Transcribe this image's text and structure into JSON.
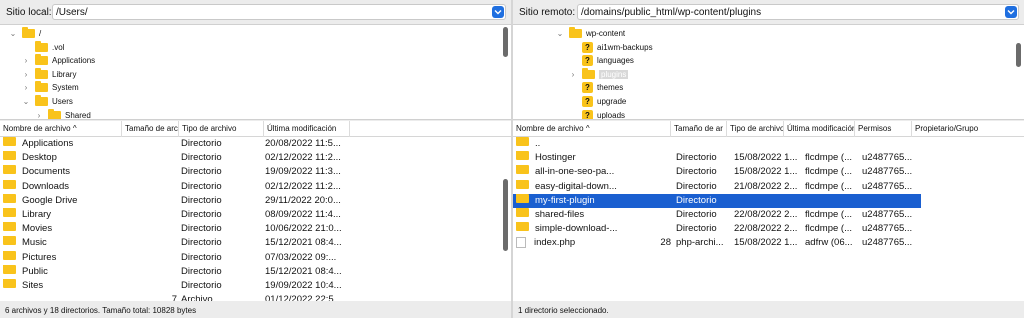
{
  "local": {
    "label": "Sitio local:",
    "path": "/Users/",
    "tree": [
      {
        "label": "/",
        "depth": 0,
        "twisty": "down"
      },
      {
        "label": ".vol",
        "depth": 1,
        "twisty": ""
      },
      {
        "label": "Applications",
        "depth": 1,
        "twisty": "right"
      },
      {
        "label": "Library",
        "depth": 1,
        "twisty": "right"
      },
      {
        "label": "System",
        "depth": 1,
        "twisty": "right"
      },
      {
        "label": "Users",
        "depth": 1,
        "twisty": "down"
      },
      {
        "label": "Shared",
        "depth": 2,
        "twisty": "right"
      }
    ],
    "columns": [
      "Nombre de archivo",
      "Tamaño de archivo",
      "Tipo de archivo",
      "Última modificación"
    ],
    "rows": [
      {
        "name": "Applications",
        "size": "",
        "type": "Directorio",
        "modified": "20/08/2022 11:5..."
      },
      {
        "name": "Desktop",
        "size": "",
        "type": "Directorio",
        "modified": "02/12/2022 11:2..."
      },
      {
        "name": "Documents",
        "size": "",
        "type": "Directorio",
        "modified": "19/09/2022 11:3..."
      },
      {
        "name": "Downloads",
        "size": "",
        "type": "Directorio",
        "modified": "02/12/2022 11:2..."
      },
      {
        "name": "Google Drive",
        "size": "",
        "type": "Directorio",
        "modified": "29/11/2022 20:0..."
      },
      {
        "name": "Library",
        "size": "",
        "type": "Directorio",
        "modified": "08/09/2022 11:4..."
      },
      {
        "name": "Movies",
        "size": "",
        "type": "Directorio",
        "modified": "10/06/2022 21:0..."
      },
      {
        "name": "Music",
        "size": "",
        "type": "Directorio",
        "modified": "15/12/2021 08:4..."
      },
      {
        "name": "Pictures",
        "size": "",
        "type": "Directorio",
        "modified": "07/03/2022 09:..."
      },
      {
        "name": "Public",
        "size": "",
        "type": "Directorio",
        "modified": "15/12/2021 08:4..."
      },
      {
        "name": "Sites",
        "size": "",
        "type": "Directorio",
        "modified": "19/09/2022 10:4..."
      },
      {
        "name": "",
        "size": "7",
        "type": "Archivo",
        "modified": "01/12/2022 22:5..."
      }
    ],
    "status": "6 archivos y 18 directorios. Tamaño total: 10828 bytes"
  },
  "remote": {
    "label": "Sitio remoto:",
    "path": "/domains/public_html/wp-content/plugins",
    "tree": [
      {
        "label": "wp-content",
        "depth": 0,
        "twisty": "down",
        "icon": "folder"
      },
      {
        "label": "ai1wm-backups",
        "depth": 1,
        "twisty": "",
        "icon": "question"
      },
      {
        "label": "languages",
        "depth": 1,
        "twisty": "",
        "icon": "question"
      },
      {
        "label": "plugins",
        "depth": 1,
        "twisty": "right",
        "icon": "folder",
        "selected": true
      },
      {
        "label": "themes",
        "depth": 1,
        "twisty": "",
        "icon": "question"
      },
      {
        "label": "upgrade",
        "depth": 1,
        "twisty": "",
        "icon": "question"
      },
      {
        "label": "uploads",
        "depth": 1,
        "twisty": "",
        "icon": "question"
      }
    ],
    "columns": [
      "Nombre de archivo",
      "Tamaño de ar",
      "Tipo de archivo",
      "Última modificación",
      "Permisos",
      "Propietario/Grupo"
    ],
    "rows": [
      {
        "name": "..",
        "size": "",
        "type": "",
        "modified": "",
        "perms": "",
        "owner": "",
        "icon": "folder"
      },
      {
        "name": "Hostinger",
        "size": "",
        "type": "Directorio",
        "modified": "15/08/2022 1...",
        "perms": "flcdmpe (...",
        "owner": "u2487765...",
        "icon": "folder"
      },
      {
        "name": "all-in-one-seo-pa...",
        "size": "",
        "type": "Directorio",
        "modified": "15/08/2022 1...",
        "perms": "flcdmpe (...",
        "owner": "u2487765...",
        "icon": "folder"
      },
      {
        "name": "easy-digital-down...",
        "size": "",
        "type": "Directorio",
        "modified": "21/08/2022 2...",
        "perms": "flcdmpe (...",
        "owner": "u2487765...",
        "icon": "folder"
      },
      {
        "name": "my-first-plugin",
        "size": "",
        "type": "Directorio",
        "modified": "",
        "perms": "",
        "owner": "",
        "icon": "folder",
        "selected": true
      },
      {
        "name": "shared-files",
        "size": "",
        "type": "Directorio",
        "modified": "22/08/2022 2...",
        "perms": "flcdmpe (...",
        "owner": "u2487765...",
        "icon": "folder"
      },
      {
        "name": "simple-download-...",
        "size": "",
        "type": "Directorio",
        "modified": "22/08/2022 2...",
        "perms": "flcdmpe (...",
        "owner": "u2487765...",
        "icon": "folder"
      },
      {
        "name": "index.php",
        "size": "28",
        "type": "php-archi...",
        "modified": "15/08/2022 1...",
        "perms": "adfrw (06...",
        "owner": "u2487765...",
        "icon": "file"
      }
    ],
    "status": "1 directorio seleccionado."
  },
  "colors": {
    "folder": "#f9c31b",
    "selection": "#1a5fd0",
    "dropdown": "#1f6fe0"
  }
}
